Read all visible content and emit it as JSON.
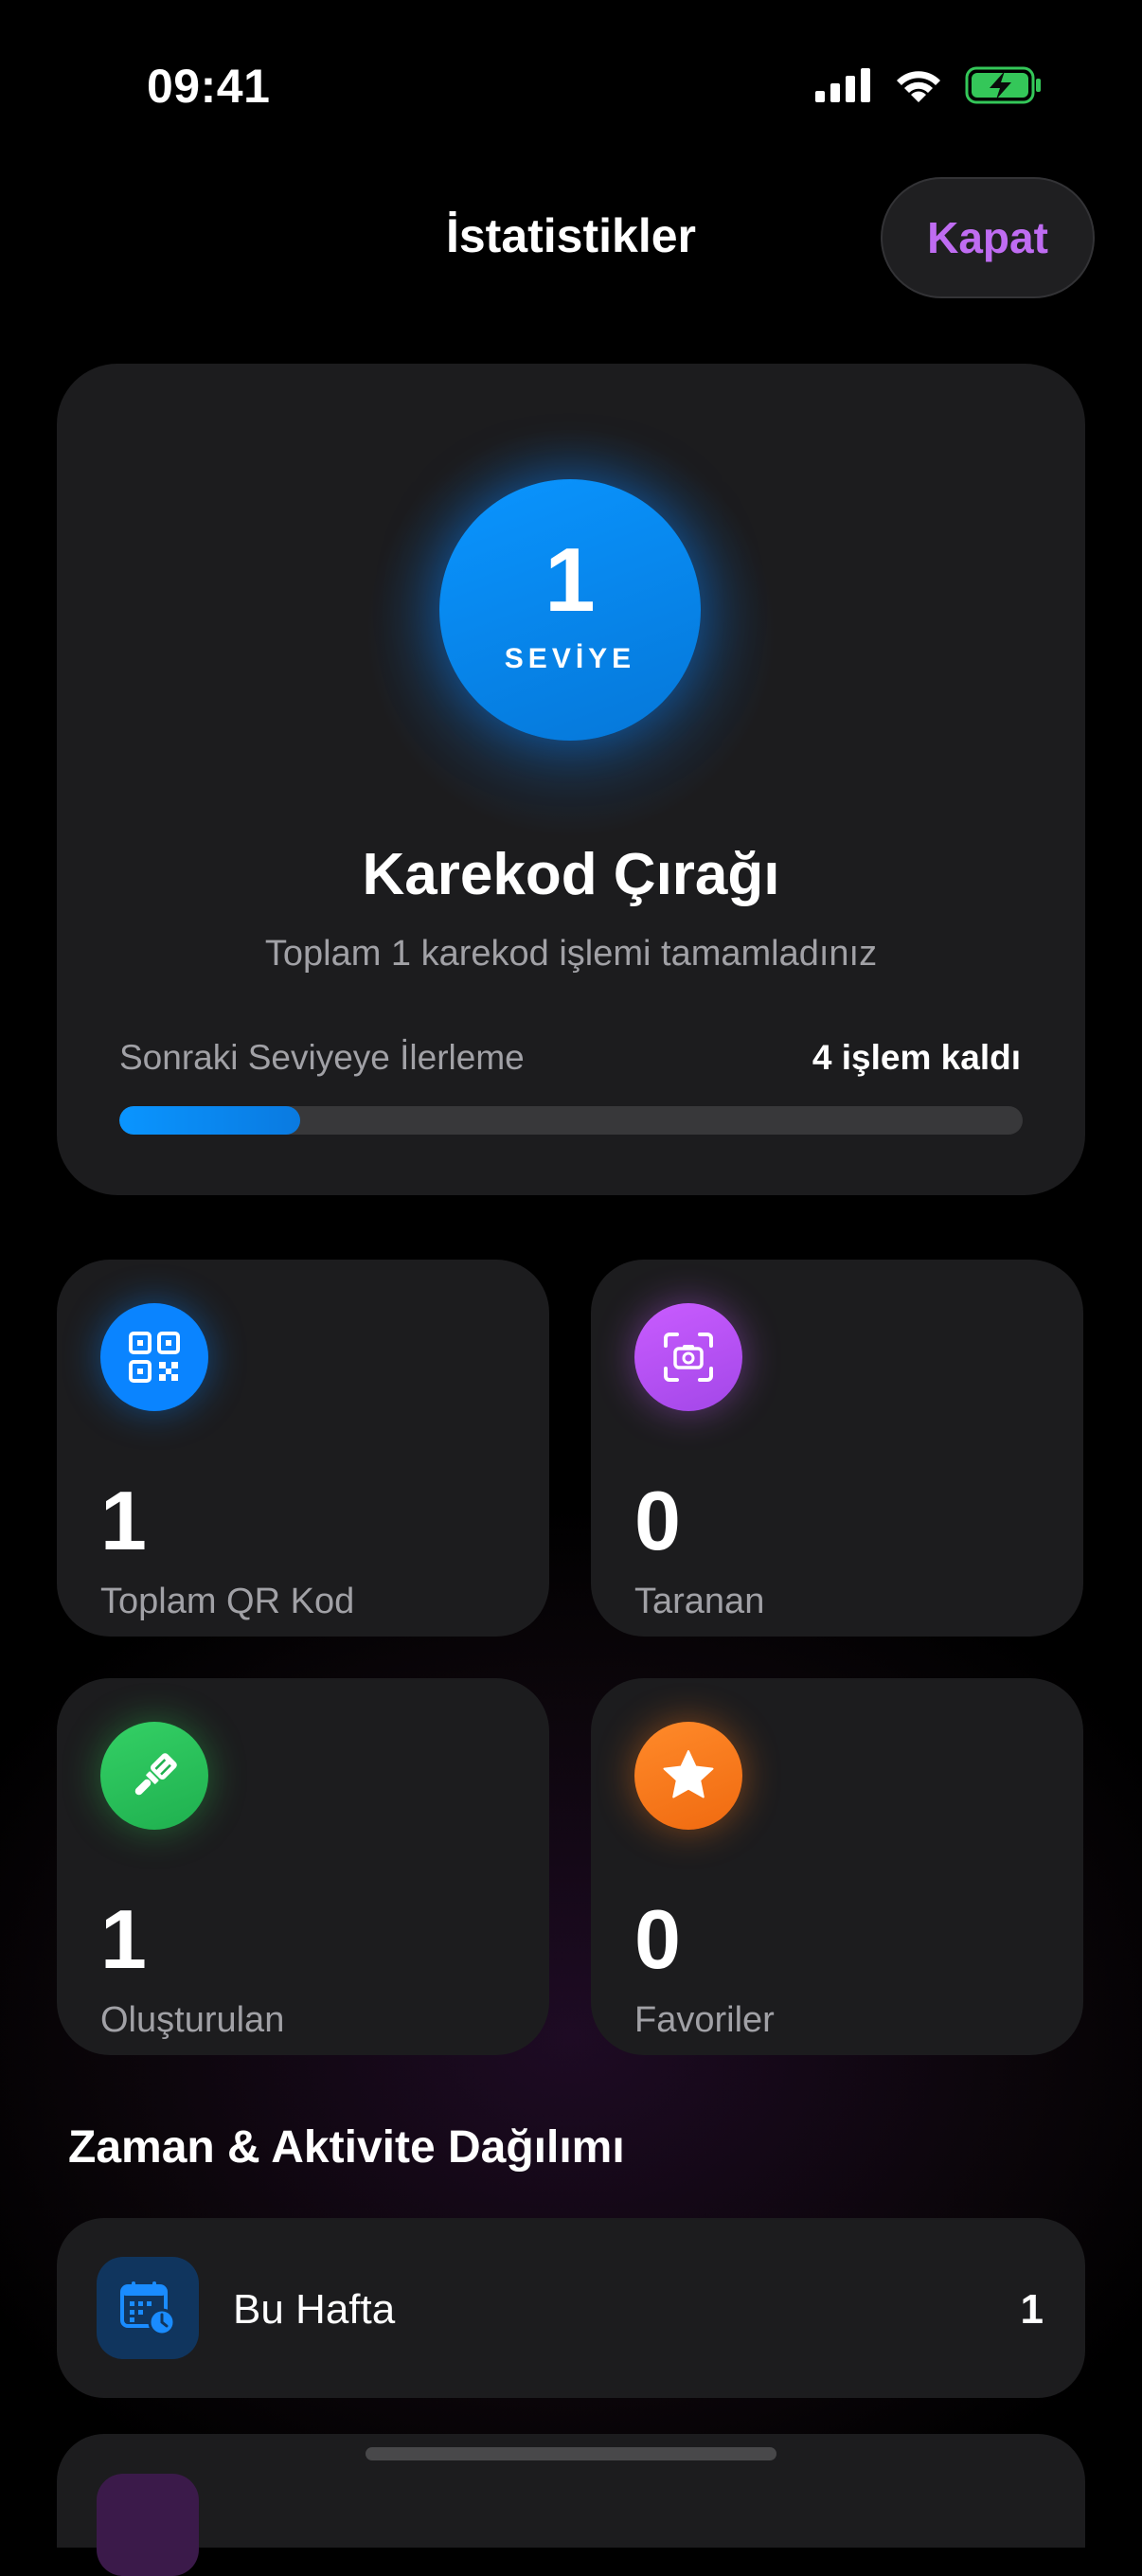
{
  "status_bar": {
    "time": "09:41"
  },
  "nav": {
    "title": "İstatistikler",
    "close_label": "Kapat"
  },
  "level": {
    "number": "1",
    "word": "SEVİYE",
    "title": "Karekod Çırağı",
    "subtitle": "Toplam 1 karekod işlemi tamamladınız",
    "progress_label": "Sonraki Seviyeye İlerleme",
    "progress_remaining": "4 işlem kaldı",
    "progress_fraction": 0.2
  },
  "stats": [
    {
      "value": "1",
      "label": "Toplam QR Kod",
      "icon": "qr-code-icon",
      "color": "#0a84ff"
    },
    {
      "value": "0",
      "label": "Taranan",
      "icon": "camera-scan-icon",
      "color": "#bf5af2"
    },
    {
      "value": "1",
      "label": "Oluşturulan",
      "icon": "paintbrush-icon",
      "color": "#30d158"
    },
    {
      "value": "0",
      "label": "Favoriler",
      "icon": "star-icon",
      "color": "#ff7a1a"
    }
  ],
  "section": {
    "title": "Zaman & Aktivite Dağılımı"
  },
  "activity": [
    {
      "label": "Bu Hafta",
      "value": "1",
      "icon": "calendar-clock-icon"
    }
  ]
}
